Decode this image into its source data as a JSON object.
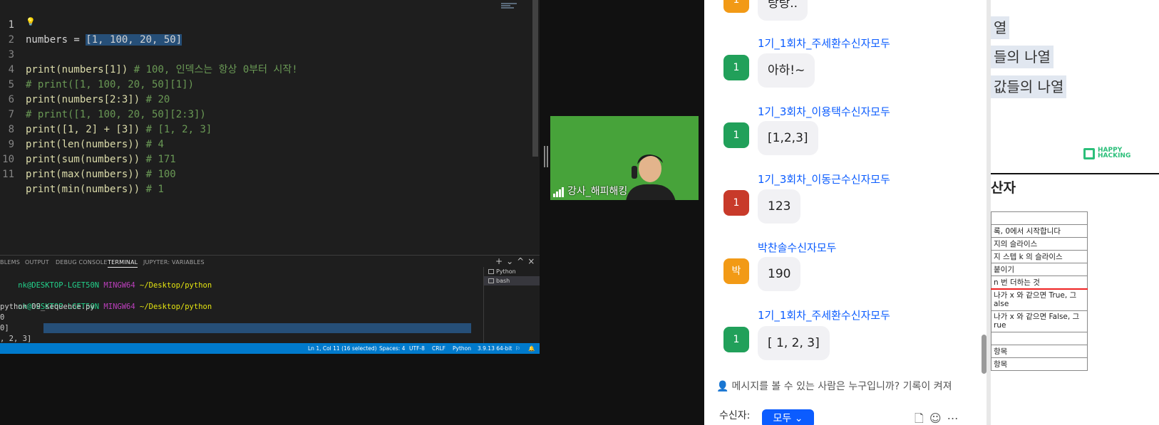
{
  "editor": {
    "lines": [
      {
        "n": "1",
        "text_plain": "numbers = ",
        "text_sel": "[1, 100, 20, 50]"
      },
      {
        "n": "2"
      },
      {
        "n": "3",
        "code": "print(numbers[1])",
        "comment": " # 100, 인덱스는 항상 0부터 시작!"
      },
      {
        "n": "4",
        "comment": "# print([1, 100, 20, 50][1])"
      },
      {
        "n": "5",
        "code": "print(numbers[2:3])",
        "comment": " # 20"
      },
      {
        "n": "6",
        "comment": "# print([1, 100, 20, 50][2:3])"
      },
      {
        "n": "7",
        "code": "print([1, 2] + [3])",
        "comment": " # [1, 2, 3]"
      },
      {
        "n": "8",
        "code": "print(len(numbers))",
        "comment": " # 4"
      },
      {
        "n": "9",
        "code": "print(sum(numbers))",
        "comment": " # 171"
      },
      {
        "n": "10",
        "code": "print(max(numbers))",
        "comment": " # 100"
      },
      {
        "n": "11",
        "code": "print(min(numbers))",
        "comment": " # 1"
      }
    ]
  },
  "panel": {
    "tabs": [
      "BLEMS",
      "OUTPUT",
      "DEBUG CONSOLE",
      "TERMINAL",
      "JUPYTER: VARIABLES"
    ],
    "actions": [
      "+",
      "⌄",
      "^",
      "×"
    ],
    "terminal": {
      "prompt_user": "nk@DESKTOP-LGET50N",
      "prompt_env": "MINGW64",
      "prompt_path": "~/Desktop/python",
      "command": "python 09_sequence.py",
      "out1": "0",
      "out2": "0]",
      "out3": ", 2, 3]"
    },
    "term_list": [
      "Python",
      "bash"
    ]
  },
  "statusbar": {
    "position": "Ln 1, Col 11 (16 selected)",
    "spaces": "Spaces: 4",
    "encoding": "UTF-8",
    "eol": "CRLF",
    "language": "Python",
    "interpreter": "3.9.13 64-bit"
  },
  "cam": {
    "label": "강사_해피해킹"
  },
  "chat": {
    "top_bubble": "랑랑..",
    "top_avatar": "1",
    "recipient_suffix": "수신자",
    "recipient_all": "모두",
    "messages": [
      {
        "name": "1기_1회차_주세환",
        "avatar": "1",
        "color": "#21a05a",
        "text": "아하!~"
      },
      {
        "name": "1기_3회차_이용택",
        "avatar": "1",
        "color": "#21a05a",
        "text": "[1,2,3]"
      },
      {
        "name": "1기_3회차_이동근",
        "avatar": "1",
        "color": "#c83a2a",
        "text": "123"
      },
      {
        "name": "박찬솔",
        "avatar": "박",
        "color": "#f29a16",
        "text": "190"
      },
      {
        "name": "1기_1회차_주세환",
        "avatar": "1",
        "color": "#21a05a",
        "text": "[ 1, 2, 3]"
      }
    ],
    "notice": "메시지를 볼 수 있는 사람은 누구입니까? 기록이 켜져",
    "recipient_label": "수신자:",
    "recipient_button": "모두"
  },
  "slide": {
    "hl1": "열",
    "hl2": "들의 나열",
    "hl3": "값들의 나열",
    "brand_line1": "HAPPY",
    "brand_line2": "HACKING",
    "title": "산자",
    "table": [
      "",
      "록, 0에서 시작합니다",
      "지의 슬라이스",
      "지 스텝 k 의 슬라이스",
      "붙이기",
      "n 번 더하는 것",
      "나가 x 와 같으면 True, 그",
      "alse",
      "나가 x 와 같으면 False, 그",
      "rue",
      "",
      "항목",
      "항목"
    ]
  }
}
